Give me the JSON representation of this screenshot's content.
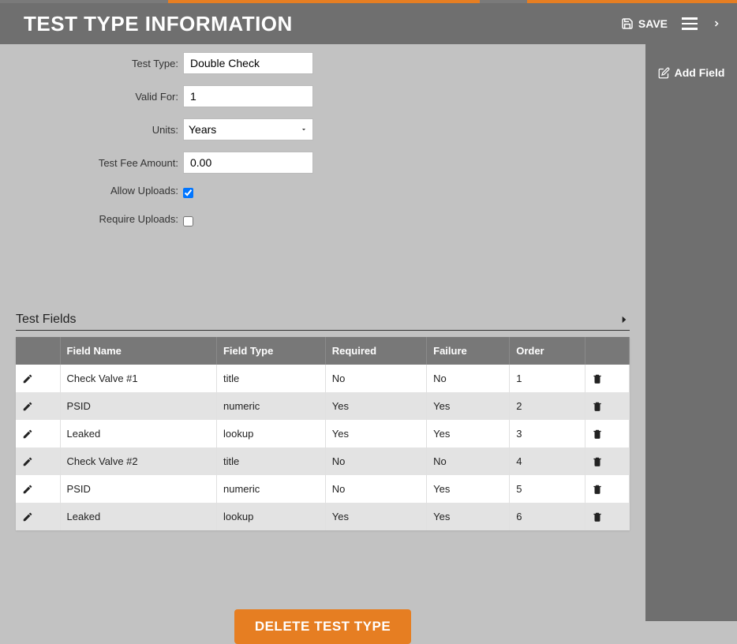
{
  "header": {
    "title": "TEST TYPE INFORMATION",
    "save_label": "SAVE"
  },
  "sidebar": {
    "add_field_label": "Add Field"
  },
  "form": {
    "labels": {
      "test_type": "Test Type:",
      "valid_for": "Valid For:",
      "units": "Units:",
      "test_fee": "Test Fee Amount:",
      "allow_uploads": "Allow Uploads:",
      "require_uploads": "Require Uploads:"
    },
    "values": {
      "test_type": "Double Check",
      "valid_for": "1",
      "units": "Years",
      "test_fee": "0.00",
      "allow_uploads": true,
      "require_uploads": false
    }
  },
  "section": {
    "title": "Test Fields"
  },
  "table": {
    "headers": {
      "field_name": "Field Name",
      "field_type": "Field Type",
      "required": "Required",
      "failure": "Failure",
      "order": "Order"
    },
    "rows": [
      {
        "name": "Check Valve #1",
        "type": "title",
        "required": "No",
        "failure": "No",
        "order": "1"
      },
      {
        "name": "PSID",
        "type": "numeric",
        "required": "Yes",
        "failure": "Yes",
        "order": "2"
      },
      {
        "name": "Leaked",
        "type": "lookup",
        "required": "Yes",
        "failure": "Yes",
        "order": "3"
      },
      {
        "name": "Check Valve #2",
        "type": "title",
        "required": "No",
        "failure": "No",
        "order": "4"
      },
      {
        "name": "PSID",
        "type": "numeric",
        "required": "No",
        "failure": "Yes",
        "order": "5"
      },
      {
        "name": "Leaked",
        "type": "lookup",
        "required": "Yes",
        "failure": "Yes",
        "order": "6"
      }
    ]
  },
  "delete_button_label": "DELETE TEST TYPE"
}
